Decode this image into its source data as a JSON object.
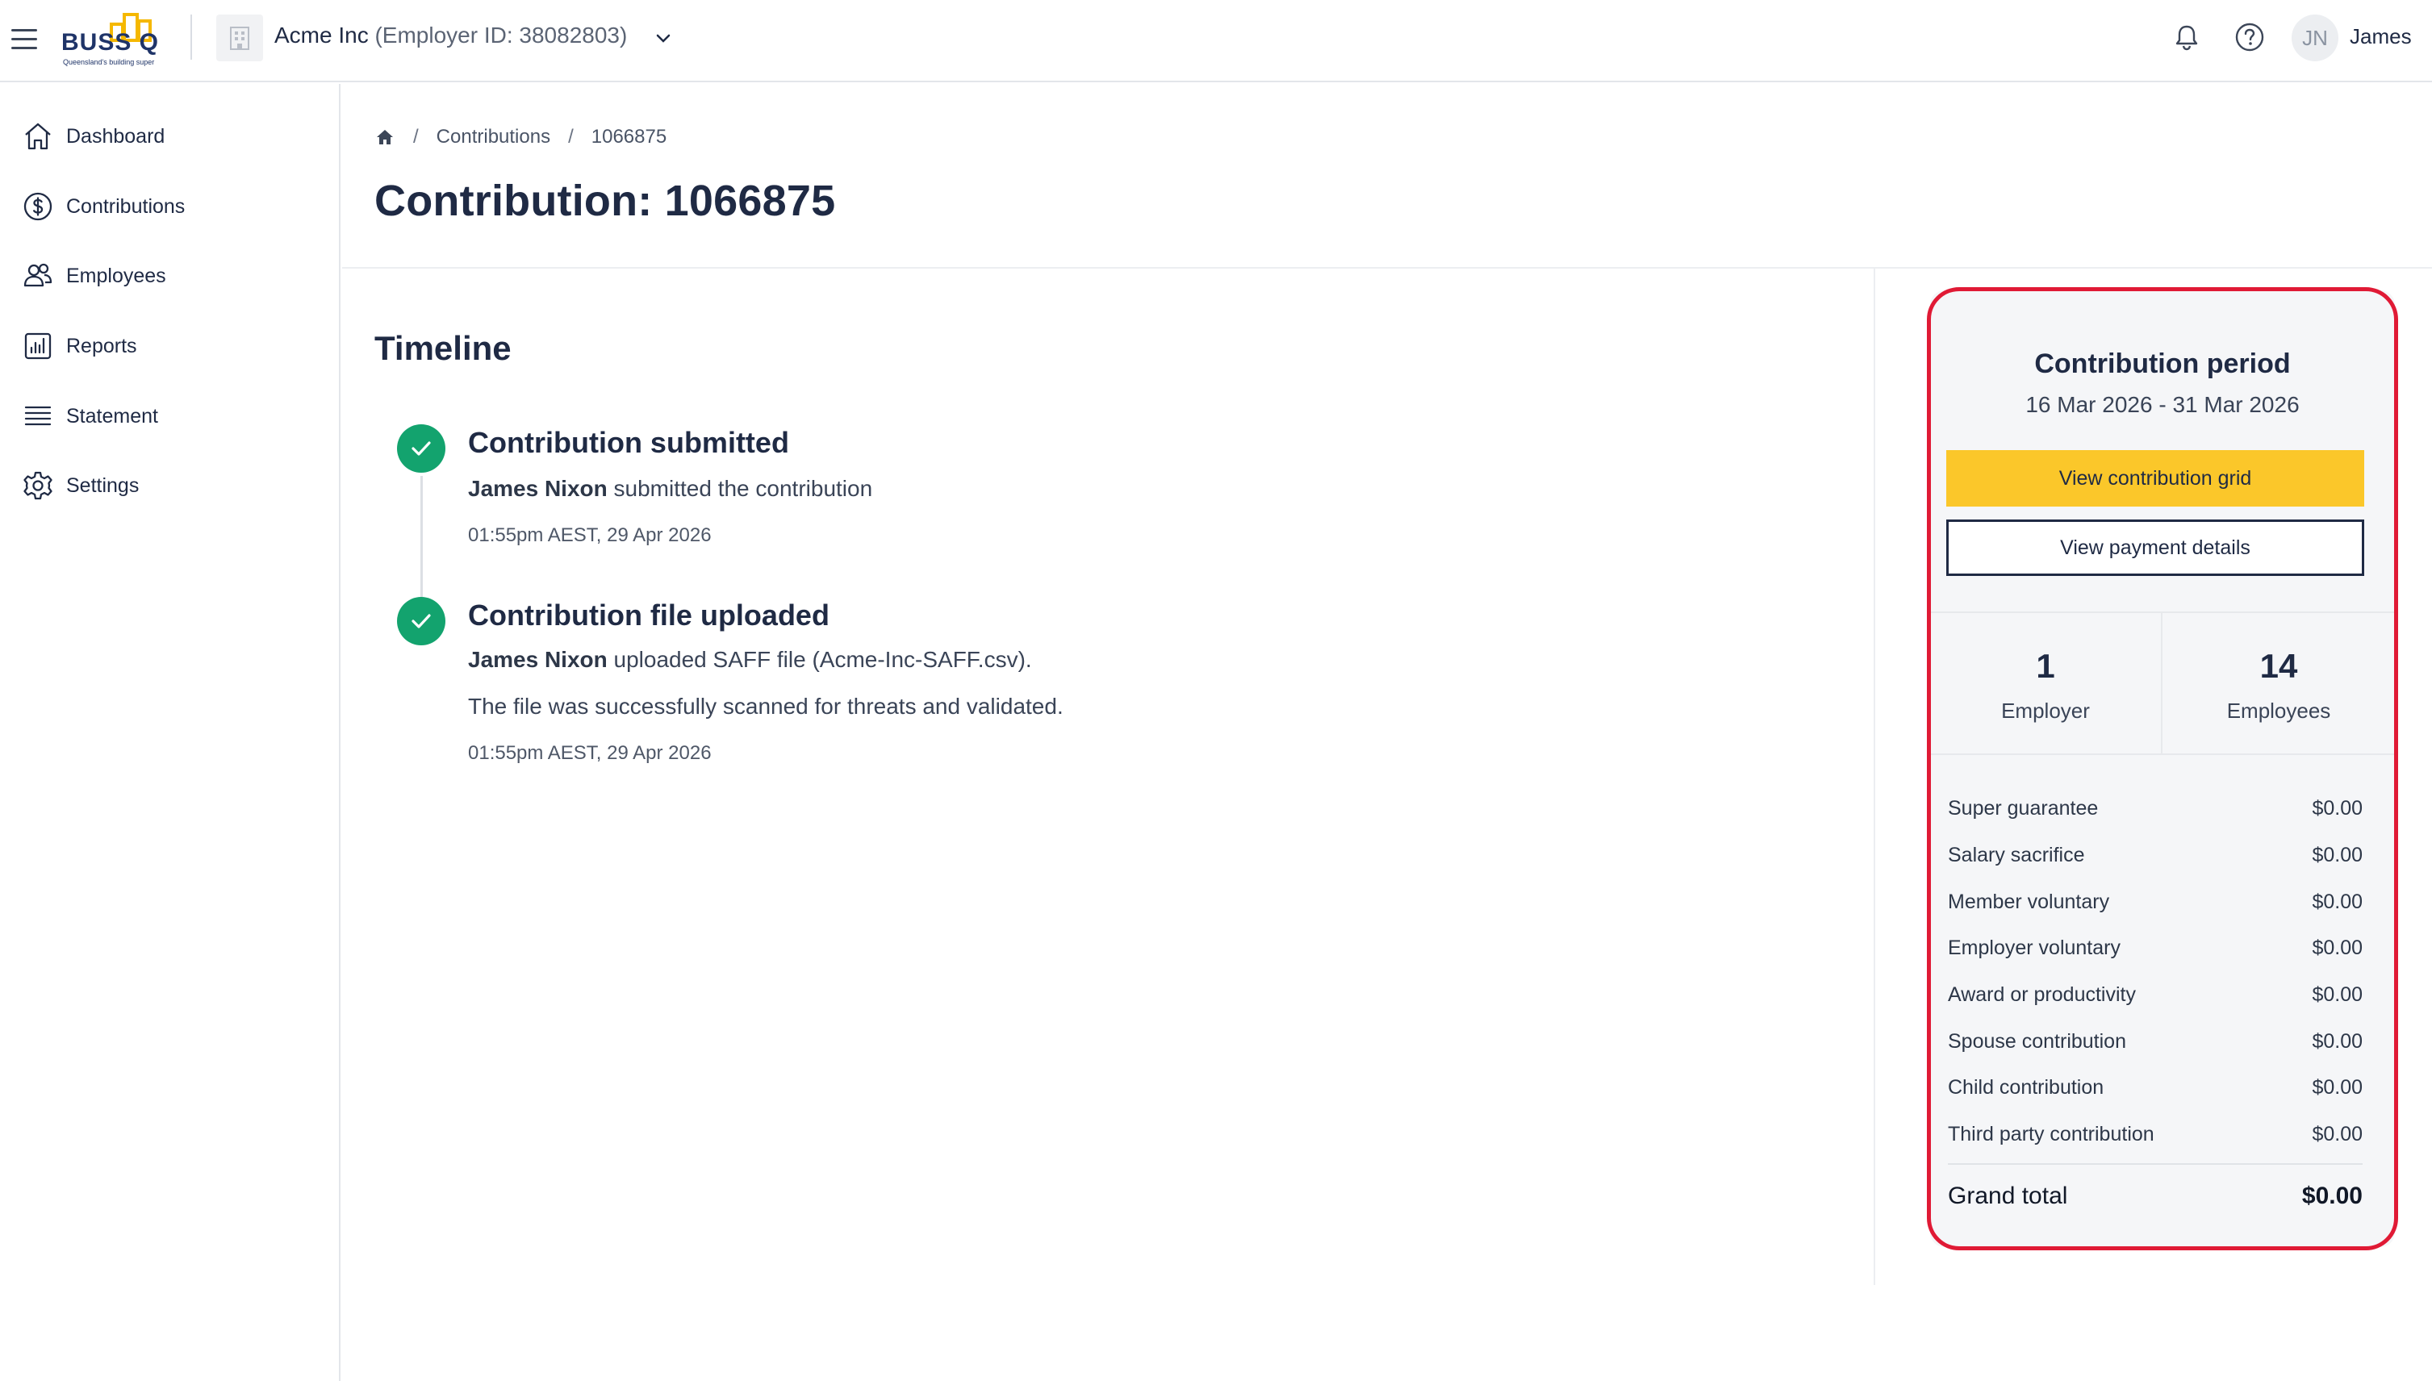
{
  "header": {
    "logo_text": "BUSS Q",
    "logo_tagline": "Queensland's building super",
    "org_name": "Acme Inc",
    "org_id": "(Employer ID: 38082803)",
    "avatar_initials": "JN",
    "user_name": "James"
  },
  "sidebar": {
    "items": [
      {
        "label": "Dashboard",
        "icon": "home-icon"
      },
      {
        "label": "Contributions",
        "icon": "dollar-circle-icon"
      },
      {
        "label": "Employees",
        "icon": "users-icon"
      },
      {
        "label": "Reports",
        "icon": "bar-chart-icon"
      },
      {
        "label": "Statement",
        "icon": "list-icon"
      },
      {
        "label": "Settings",
        "icon": "gear-icon"
      }
    ]
  },
  "breadcrumb": {
    "items": [
      "Contributions",
      "1066875"
    ],
    "separator": "/"
  },
  "page": {
    "title": "Contribution: 1066875"
  },
  "timeline": {
    "title": "Timeline",
    "events": [
      {
        "heading": "Contribution submitted",
        "actor": "James Nixon",
        "text": "submitted the contribution",
        "timestamp": "01:55pm AEST, 29 Apr 2026"
      },
      {
        "heading": "Contribution file uploaded",
        "actor": "James Nixon",
        "text": "uploaded SAFF file (Acme-Inc-SAFF.csv).",
        "extra": "The file was successfully scanned for threats and validated.",
        "timestamp": "01:55pm AEST, 29 Apr 2026"
      }
    ]
  },
  "summary": {
    "period_title": "Contribution period",
    "period_range": "16 Mar 2026 - 31 Mar 2026",
    "primary_button": "View contribution grid",
    "secondary_button": "View payment details",
    "stats": [
      {
        "value": "1",
        "label": "Employer"
      },
      {
        "value": "14",
        "label": "Employees"
      }
    ],
    "rows": [
      {
        "label": "Super guarantee",
        "value": "$0.00"
      },
      {
        "label": "Salary sacrifice",
        "value": "$0.00"
      },
      {
        "label": "Member voluntary",
        "value": "$0.00"
      },
      {
        "label": "Employer voluntary",
        "value": "$0.00"
      },
      {
        "label": "Award or productivity",
        "value": "$0.00"
      },
      {
        "label": "Spouse contribution",
        "value": "$0.00"
      },
      {
        "label": "Child contribution",
        "value": "$0.00"
      },
      {
        "label": "Third party contribution",
        "value": "$0.00"
      }
    ],
    "grand_total_label": "Grand total",
    "grand_total_value": "$0.00"
  },
  "colors": {
    "accent_yellow": "#fbc72a",
    "success_green": "#13a36e",
    "highlight_red": "#e01a35",
    "navy": "#1f2a44"
  }
}
